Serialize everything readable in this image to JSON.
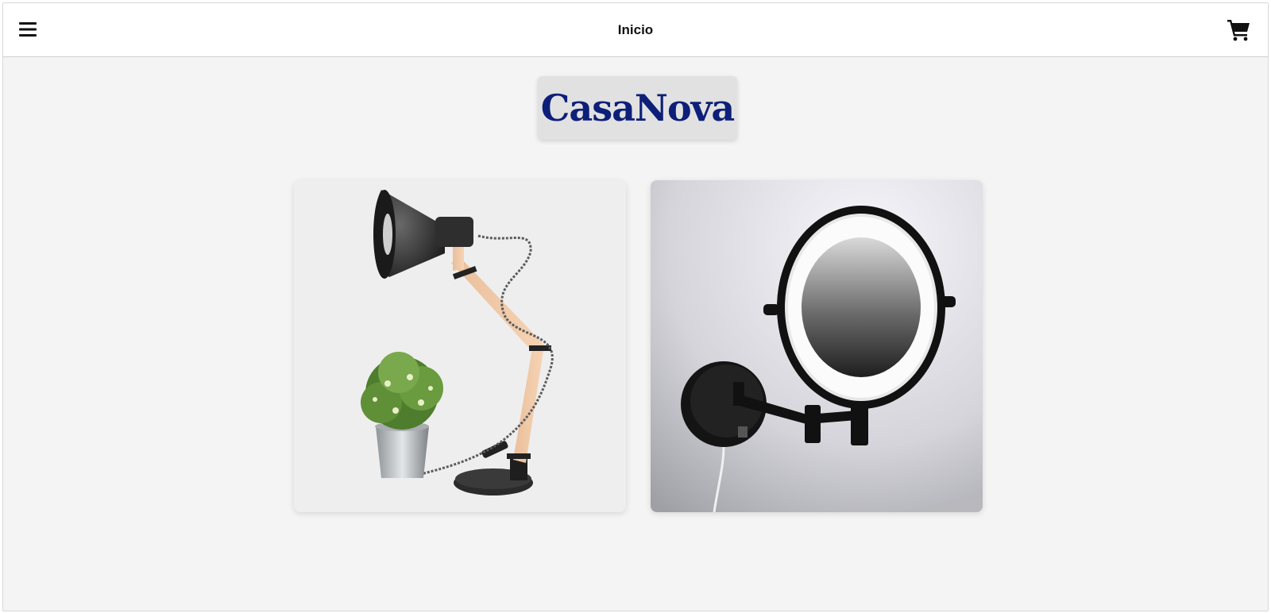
{
  "header": {
    "title": "Inicio",
    "menu_icon": "hamburger-menu-icon",
    "cart_icon": "shopping-cart-icon"
  },
  "brand": {
    "name": "CasaNova",
    "color": "#0d1f78"
  },
  "products": [
    {
      "image": "desk-lamp-with-plant"
    },
    {
      "image": "lighted-wall-mirror"
    }
  ]
}
